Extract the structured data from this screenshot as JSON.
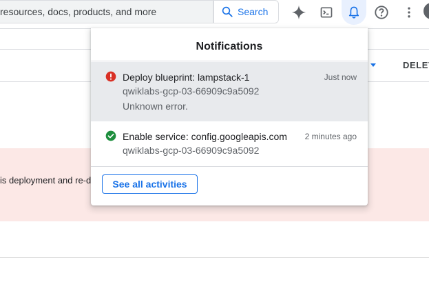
{
  "search": {
    "placeholder": "resources, docs, products, and more",
    "button_label": "Search"
  },
  "topbar_icons": [
    "gemini-sparkle-icon",
    "cloud-shell-icon",
    "notifications-bell-icon",
    "help-icon",
    "more-vert-icon"
  ],
  "page": {
    "delete_label": "DELET",
    "error_text": "is deployment and re-d"
  },
  "notifications": {
    "title": "Notifications",
    "items": [
      {
        "status": "error",
        "title": "Deploy blueprint: lampstack-1",
        "project": "qwiklabs-gcp-03-66909c9a5092",
        "detail": "Unknown error.",
        "time": "Just now"
      },
      {
        "status": "success",
        "title": "Enable service: config.googleapis.com",
        "project": "qwiklabs-gcp-03-66909c9a5092",
        "time": "2 minutes ago"
      }
    ],
    "see_all_label": "See all activities"
  },
  "colors": {
    "accent": "#1a73e8",
    "error": "#d93025",
    "success": "#1e8e3e",
    "error_banner": "#fce8e6"
  }
}
